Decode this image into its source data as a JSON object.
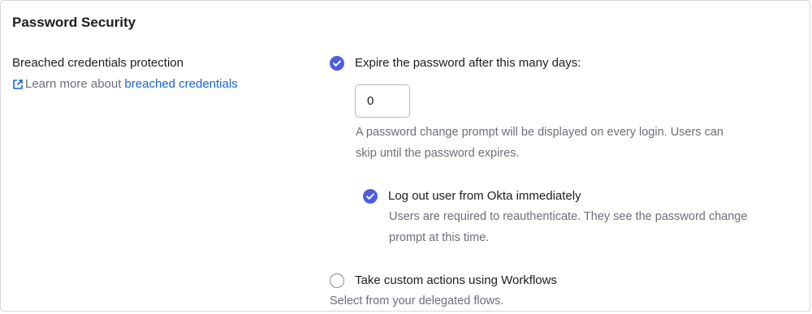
{
  "section": {
    "title": "Password Security",
    "left_label": "Breached credentials protection",
    "learn_more_prefix": "Learn more about",
    "learn_more_link": "breached credentials",
    "learn_more_icon": "external-link-icon"
  },
  "options": {
    "expire": {
      "checked": true,
      "label": "Expire the password after this many days:",
      "days_value": "0",
      "hint_line1": "A password change prompt will be displayed on every login. Users can",
      "hint_line2": "skip until the password expires."
    },
    "logout": {
      "checked": true,
      "label": "Log out user from Okta immediately",
      "hint_line1": "Users are required to reauthenticate. They see the password change",
      "hint_line2": "prompt at this time."
    },
    "workflows": {
      "checked": false,
      "label": "Take custom actions using Workflows",
      "hint": "Select from your delegated flows."
    }
  },
  "colors": {
    "accent": "#4e5de0",
    "link": "#1662dd",
    "muted_text": "#6e6e78",
    "border": "#d7d7dc"
  }
}
